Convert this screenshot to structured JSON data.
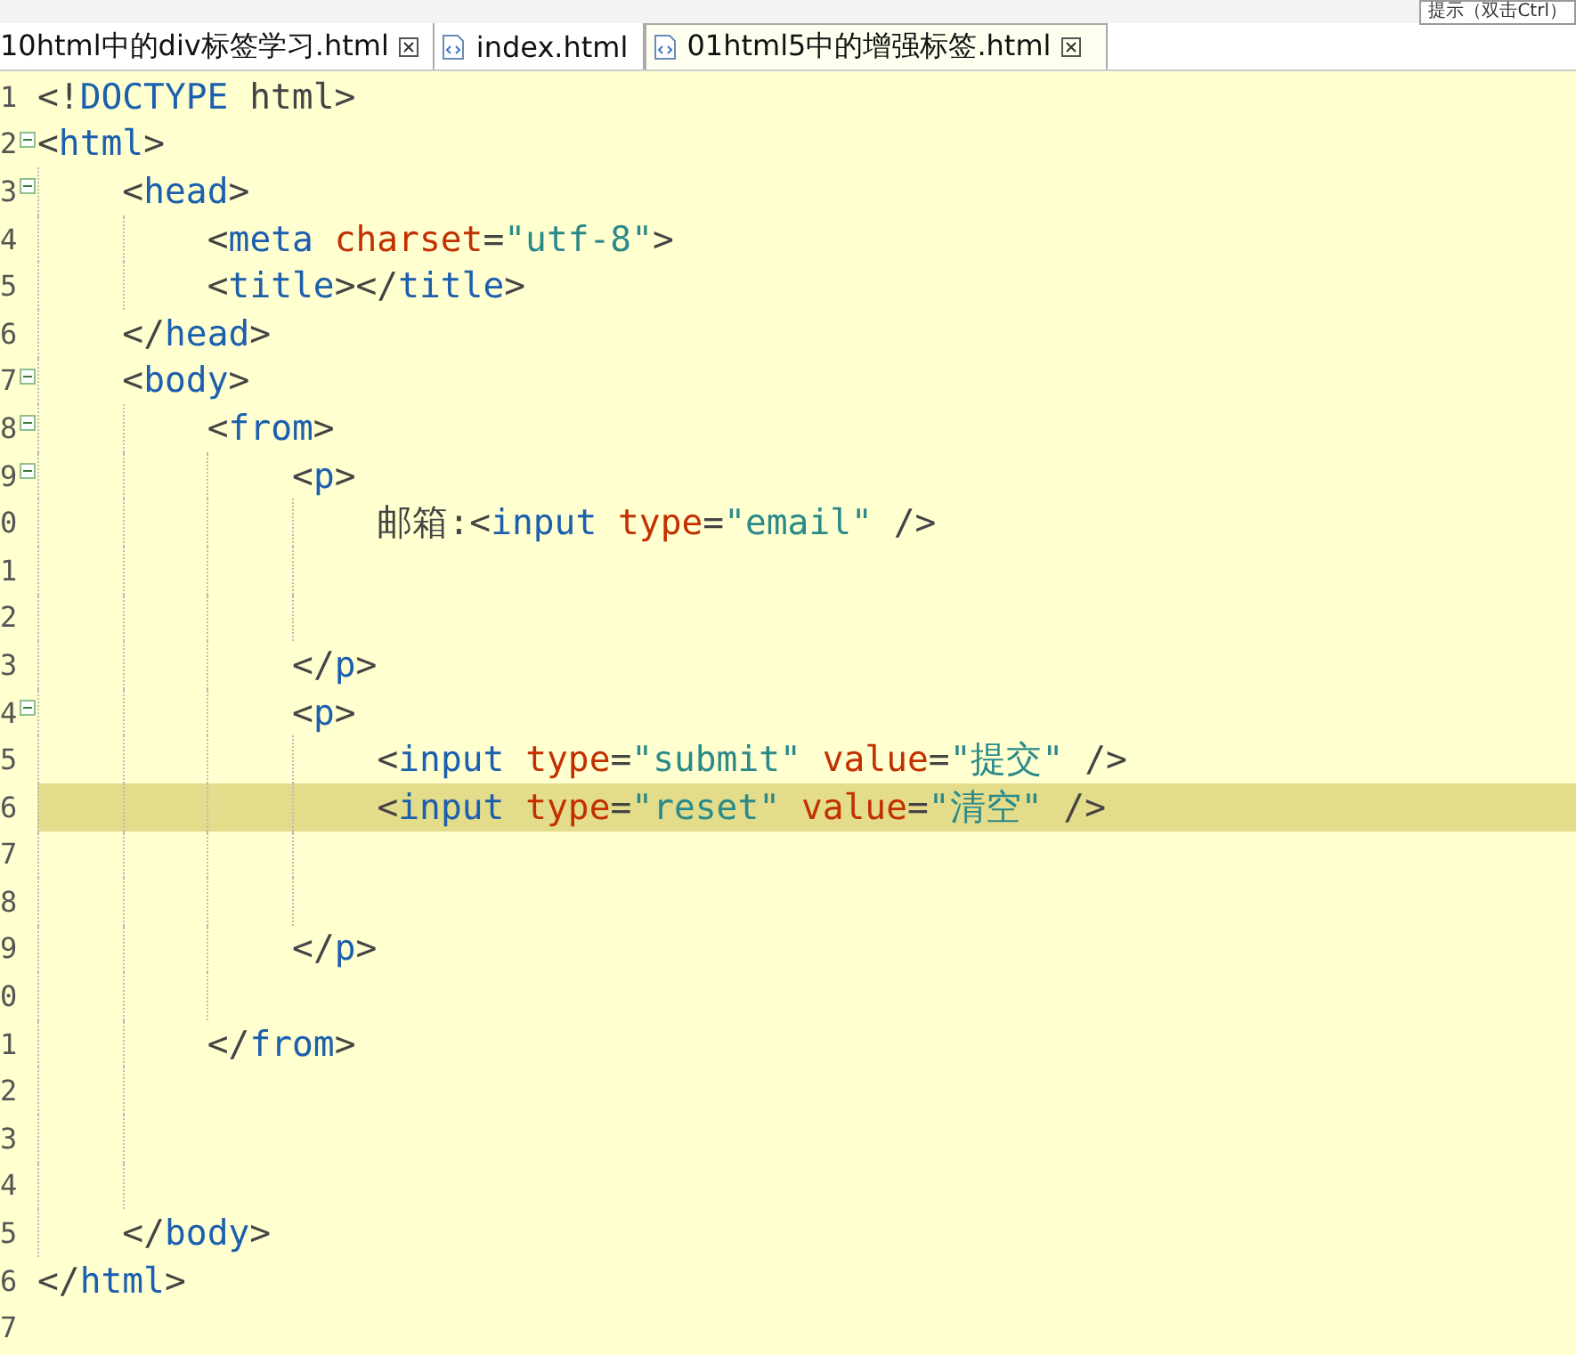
{
  "toolbar": {
    "search": {
      "placeholder": "提示（双击Ctrl）"
    }
  },
  "tabs": [
    {
      "label": "10html中的div标签学习.html",
      "selected": false,
      "icon": false,
      "closable": true
    },
    {
      "label": "index.html",
      "selected": false,
      "icon": true,
      "closable": false
    },
    {
      "label": "01html5中的增强标签.html",
      "selected": true,
      "icon": true,
      "closable": true
    }
  ],
  "lines": [
    {
      "number": "1",
      "foldable": false,
      "current": false,
      "tokens": [
        {
          "kind": "punct",
          "text": "<!"
        },
        {
          "kind": "tag",
          "text": "DOCTYPE"
        },
        {
          "kind": "plain",
          "text": " html>"
        }
      ]
    },
    {
      "number": "2",
      "foldable": true,
      "current": false,
      "tokens": [
        {
          "kind": "punct",
          "text": "<"
        },
        {
          "kind": "tag",
          "text": "html"
        },
        {
          "kind": "punct",
          "text": ">"
        }
      ],
      "children": [
        {
          "number": "3",
          "foldable": true,
          "current": false,
          "tokens": [
            {
              "kind": "punct",
              "text": "<"
            },
            {
              "kind": "tag",
              "text": "head"
            },
            {
              "kind": "punct",
              "text": ">"
            }
          ],
          "children": [
            {
              "number": "4",
              "foldable": false,
              "current": false,
              "tokens": [
                {
                  "kind": "punct",
                  "text": "<"
                },
                {
                  "kind": "tag",
                  "text": "meta"
                },
                {
                  "kind": "attr",
                  "text": " charset"
                },
                {
                  "kind": "punct",
                  "text": "="
                },
                {
                  "kind": "value",
                  "text": "\"utf-8\""
                },
                {
                  "kind": "punct",
                  "text": ">"
                }
              ]
            },
            {
              "number": "5",
              "foldable": false,
              "current": false,
              "tokens": [
                {
                  "kind": "punct",
                  "text": "<"
                },
                {
                  "kind": "tag",
                  "text": "title"
                },
                {
                  "kind": "punct",
                  "text": "></"
                },
                {
                  "kind": "tag",
                  "text": "title"
                },
                {
                  "kind": "punct",
                  "text": ">"
                }
              ]
            }
          ]
        },
        {
          "number": "6",
          "foldable": false,
          "current": false,
          "tokens": [
            {
              "kind": "punct",
              "text": "</"
            },
            {
              "kind": "tag",
              "text": "head"
            },
            {
              "kind": "punct",
              "text": ">"
            }
          ]
        },
        {
          "number": "7",
          "foldable": true,
          "current": false,
          "tokens": [
            {
              "kind": "punct",
              "text": "<"
            },
            {
              "kind": "tag",
              "text": "body"
            },
            {
              "kind": "punct",
              "text": ">"
            }
          ],
          "children": [
            {
              "number": "8",
              "foldable": true,
              "current": false,
              "tokens": [
                {
                  "kind": "punct",
                  "text": "<"
                },
                {
                  "kind": "tag",
                  "text": "from"
                },
                {
                  "kind": "punct",
                  "text": ">"
                }
              ],
              "children": [
                {
                  "number": "9",
                  "foldable": true,
                  "current": false,
                  "tokens": [
                    {
                      "kind": "punct",
                      "text": "<"
                    },
                    {
                      "kind": "tag",
                      "text": "p"
                    },
                    {
                      "kind": "punct",
                      "text": ">"
                    }
                  ],
                  "children": [
                    {
                      "number": "0",
                      "foldable": false,
                      "current": false,
                      "tokens": [
                        {
                          "kind": "plain",
                          "text": "邮箱:"
                        },
                        {
                          "kind": "punct",
                          "text": "<"
                        },
                        {
                          "kind": "tag",
                          "text": "input"
                        },
                        {
                          "kind": "attr",
                          "text": " type"
                        },
                        {
                          "kind": "punct",
                          "text": "="
                        },
                        {
                          "kind": "value",
                          "text": "\"email\""
                        },
                        {
                          "kind": "punct",
                          "text": " />"
                        }
                      ]
                    },
                    {
                      "number": "1",
                      "foldable": false,
                      "current": false
                    },
                    {
                      "number": "2",
                      "foldable": false,
                      "current": false
                    }
                  ]
                },
                {
                  "number": "3",
                  "foldable": false,
                  "current": false,
                  "tokens": [
                    {
                      "kind": "punct",
                      "text": "</"
                    },
                    {
                      "kind": "tag",
                      "text": "p"
                    },
                    {
                      "kind": "punct",
                      "text": ">"
                    }
                  ]
                },
                {
                  "number": "4",
                  "foldable": true,
                  "current": false,
                  "tokens": [
                    {
                      "kind": "punct",
                      "text": "<"
                    },
                    {
                      "kind": "tag",
                      "text": "p"
                    },
                    {
                      "kind": "punct",
                      "text": ">"
                    }
                  ],
                  "children": [
                    {
                      "number": "5",
                      "foldable": false,
                      "current": false,
                      "tokens": [
                        {
                          "kind": "punct",
                          "text": "<"
                        },
                        {
                          "kind": "tag",
                          "text": "input"
                        },
                        {
                          "kind": "attr",
                          "text": " type"
                        },
                        {
                          "kind": "punct",
                          "text": "="
                        },
                        {
                          "kind": "value",
                          "text": "\"submit\""
                        },
                        {
                          "kind": "attr",
                          "text": " value"
                        },
                        {
                          "kind": "punct",
                          "text": "="
                        },
                        {
                          "kind": "value",
                          "text": "\"提交\""
                        },
                        {
                          "kind": "punct",
                          "text": " />"
                        }
                      ]
                    },
                    {
                      "number": "6",
                      "foldable": false,
                      "current": true,
                      "tokens": [
                        {
                          "kind": "punct",
                          "text": "<"
                        },
                        {
                          "kind": "tag",
                          "text": "input"
                        },
                        {
                          "kind": "attr",
                          "text": " type"
                        },
                        {
                          "kind": "punct",
                          "text": "="
                        },
                        {
                          "kind": "value",
                          "text": "\"reset\""
                        },
                        {
                          "kind": "attr",
                          "text": " value"
                        },
                        {
                          "kind": "punct",
                          "text": "="
                        },
                        {
                          "kind": "value",
                          "text": "\"清空\""
                        },
                        {
                          "kind": "punct",
                          "text": " />"
                        }
                      ]
                    },
                    {
                      "number": "7",
                      "foldable": false,
                      "current": false
                    },
                    {
                      "number": "8",
                      "foldable": false,
                      "current": false
                    }
                  ]
                },
                {
                  "number": "9",
                  "foldable": false,
                  "current": false,
                  "tokens": [
                    {
                      "kind": "punct",
                      "text": "</"
                    },
                    {
                      "kind": "tag",
                      "text": "p"
                    },
                    {
                      "kind": "punct",
                      "text": ">"
                    }
                  ]
                },
                {
                  "number": "0",
                  "foldable": false,
                  "current": false
                }
              ]
            },
            {
              "number": "1",
              "foldable": false,
              "current": false,
              "tokens": [
                {
                  "kind": "punct",
                  "text": "</"
                },
                {
                  "kind": "tag",
                  "text": "from"
                },
                {
                  "kind": "punct",
                  "text": ">"
                }
              ]
            },
            {
              "number": "2",
              "foldable": false,
              "current": false
            },
            {
              "number": "3",
              "foldable": false,
              "current": false
            },
            {
              "number": "4",
              "foldable": false,
              "current": false
            }
          ]
        },
        {
          "number": "5",
          "foldable": false,
          "current": false,
          "tokens": [
            {
              "kind": "punct",
              "text": "</"
            },
            {
              "kind": "tag",
              "text": "body"
            },
            {
              "kind": "punct",
              "text": ">"
            }
          ]
        }
      ]
    },
    {
      "number": "6",
      "foldable": false,
      "current": false,
      "tokens": [
        {
          "kind": "punct",
          "text": "</"
        },
        {
          "kind": "tag",
          "text": "html"
        },
        {
          "kind": "punct",
          "text": ">"
        }
      ]
    },
    {
      "number": "7",
      "foldable": false,
      "current": false
    }
  ]
}
